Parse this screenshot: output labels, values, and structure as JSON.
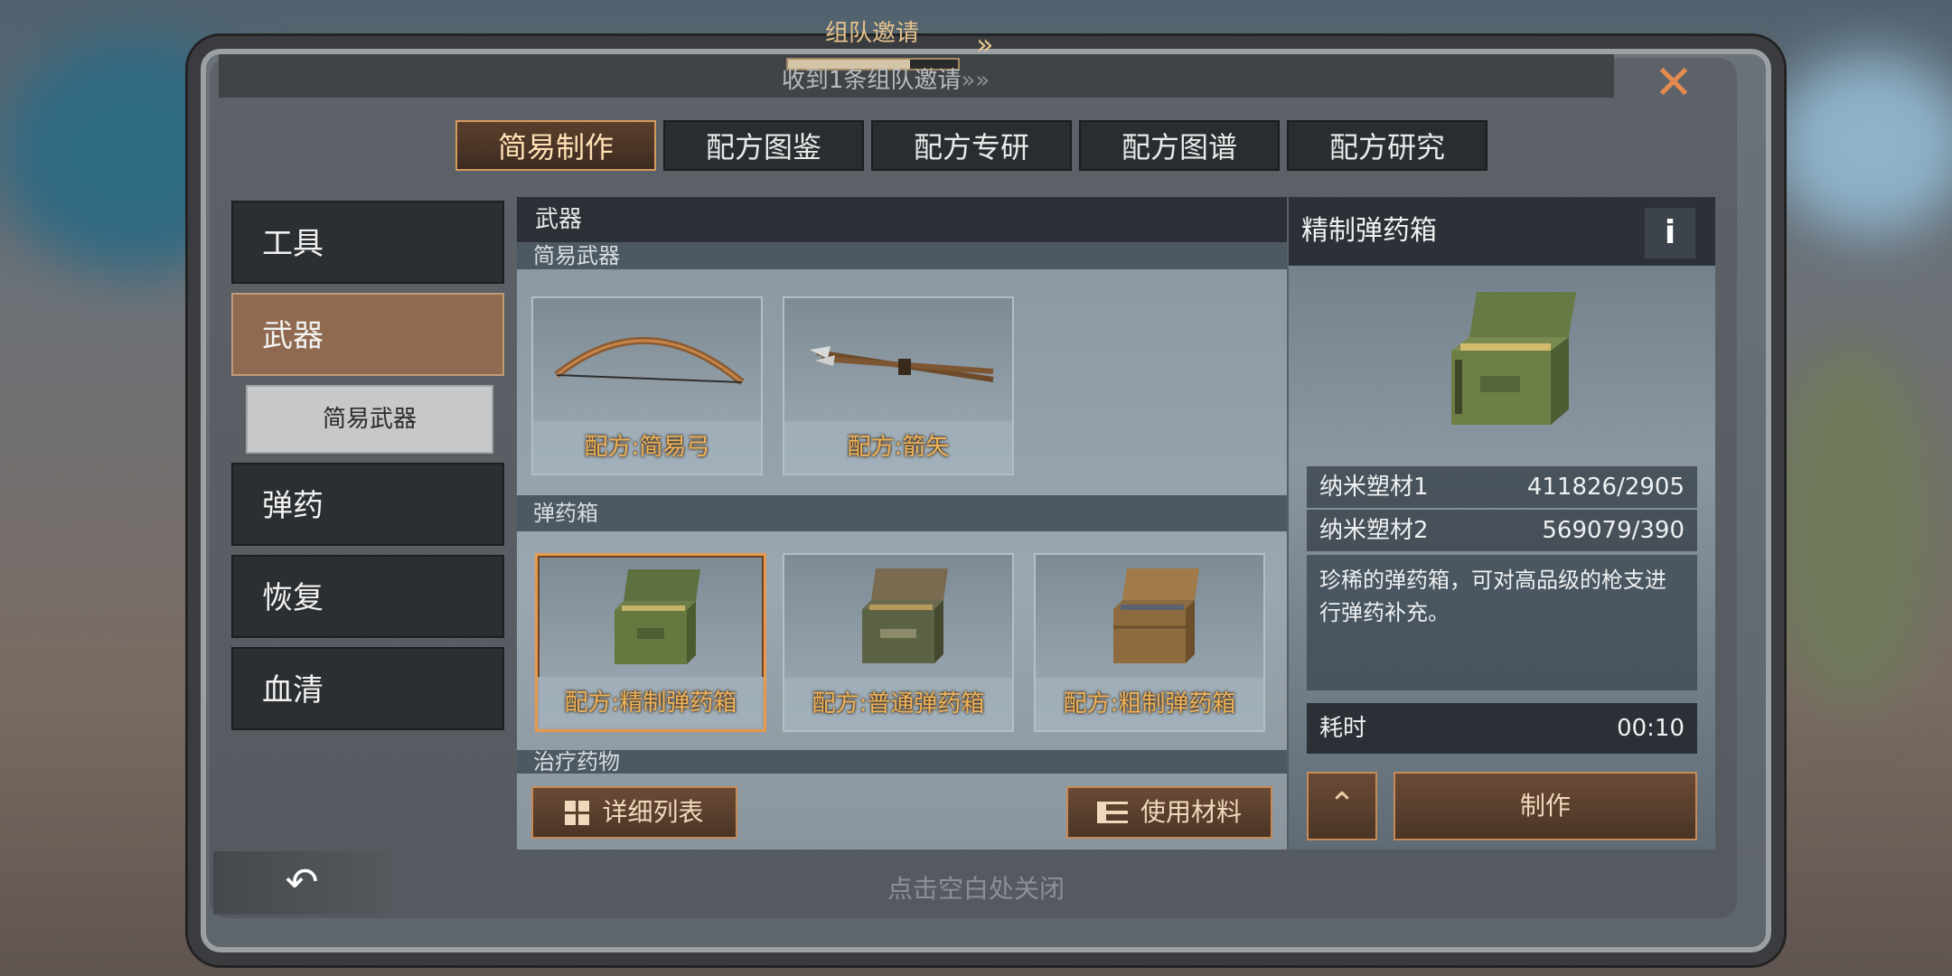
{
  "invite": {
    "title": "组队邀请",
    "subtitle": "收到1条组队邀请",
    "arrow": "»",
    "sub_arrow": "»»",
    "progress": 0.72
  },
  "close_icon": "✕",
  "tabs": [
    {
      "label": "简易制作",
      "active": true
    },
    {
      "label": "配方图鉴",
      "active": false
    },
    {
      "label": "配方专研",
      "active": false
    },
    {
      "label": "配方图谱",
      "active": false
    },
    {
      "label": "配方研究",
      "active": false
    }
  ],
  "sidebar": {
    "items": [
      {
        "label": "工具"
      },
      {
        "label": "武器",
        "active": true
      },
      {
        "label": "弹药"
      },
      {
        "label": "恢复"
      },
      {
        "label": "血清"
      }
    ],
    "sub_item": "简易武器"
  },
  "grid": {
    "header": "武器",
    "sections": [
      {
        "title": "简易武器",
        "cards": [
          {
            "label": "配方:简易弓",
            "icon": "bow-icon"
          },
          {
            "label": "配方:箭矢",
            "icon": "arrows-icon"
          }
        ]
      },
      {
        "title": "弹药箱",
        "cards": [
          {
            "label": "配方:精制弹药箱",
            "icon": "ammo-box-icon",
            "selected": true
          },
          {
            "label": "配方:普通弹药箱",
            "icon": "ammo-box-icon"
          },
          {
            "label": "配方:粗制弹药箱",
            "icon": "ammo-box-icon"
          }
        ]
      },
      {
        "title": "治疗药物"
      }
    ],
    "detail_list_btn": "详细列表",
    "use_materials_btn": "使用材料"
  },
  "detail": {
    "title": "精制弹药箱",
    "info": "i",
    "materials": [
      {
        "name": "纳米塑材1",
        "count": "411826/2905"
      },
      {
        "name": "纳米塑材2",
        "count": "569079/390"
      }
    ],
    "description": "珍稀的弹药箱，可对高品级的枪支进行弹药补充。",
    "time_label": "耗时",
    "time_value": "00:10",
    "craft_btn": "制作"
  },
  "back_icon": "↶",
  "hint": "点击空白处关闭",
  "colors": {
    "accent": "#e79a4c",
    "label_gold": "#f0b35a",
    "active_sidebar": "#8f6a50"
  }
}
